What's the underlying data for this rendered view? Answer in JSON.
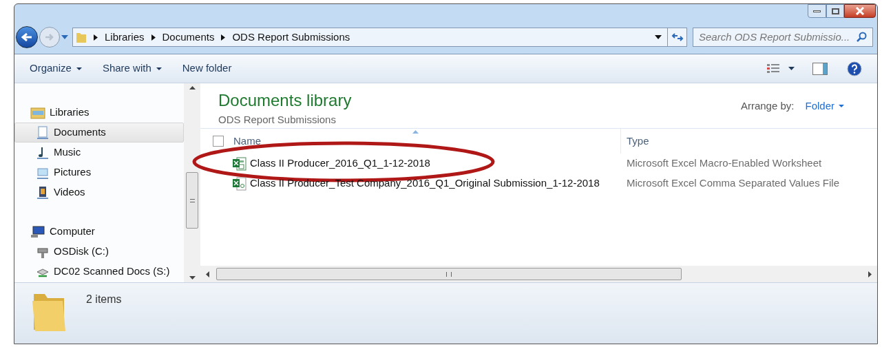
{
  "address_bar": {
    "crumbs": [
      "Libraries",
      "Documents",
      "ODS Report Submissions"
    ]
  },
  "search": {
    "placeholder": "Search ODS Report Submissio..."
  },
  "toolbar": {
    "buttons": [
      {
        "label": "Organize",
        "dropdown": true
      },
      {
        "label": "Share with",
        "dropdown": true
      },
      {
        "label": "New folder",
        "dropdown": false
      }
    ]
  },
  "sidebar": {
    "items": [
      {
        "label": "Libraries",
        "kind": "library",
        "selected": false,
        "children": [
          {
            "label": "Documents",
            "kind": "documents",
            "selected": true
          },
          {
            "label": "Music",
            "kind": "music",
            "selected": false
          },
          {
            "label": "Pictures",
            "kind": "pictures",
            "selected": false
          },
          {
            "label": "Videos",
            "kind": "videos",
            "selected": false
          }
        ]
      },
      {
        "label": "Computer",
        "kind": "computer",
        "selected": false,
        "children": [
          {
            "label": "OSDisk (C:)",
            "kind": "disk",
            "selected": false
          },
          {
            "label": "DC02 Scanned Docs (S:)",
            "kind": "network",
            "selected": false
          }
        ]
      }
    ]
  },
  "library": {
    "title": "Documents library",
    "subtitle": "ODS Report Submissions",
    "arrange_label": "Arrange by:",
    "arrange_value": "Folder"
  },
  "table": {
    "select_all_checked": false,
    "columns": [
      "Name",
      "Type"
    ],
    "rows": [
      {
        "name": "Class II Producer_2016_Q1_1-12-2018",
        "type": "Microsoft Excel Macro-Enabled Worksheet",
        "kind": "xlsm",
        "highlighted": true
      },
      {
        "name": "Class II Producer_Test Company_2016_Q1_Original Submission_1-12-2018",
        "type": "Microsoft Excel Comma Separated Values File",
        "kind": "csv",
        "highlighted": false
      }
    ]
  },
  "status_bar": {
    "count": "2 items"
  }
}
